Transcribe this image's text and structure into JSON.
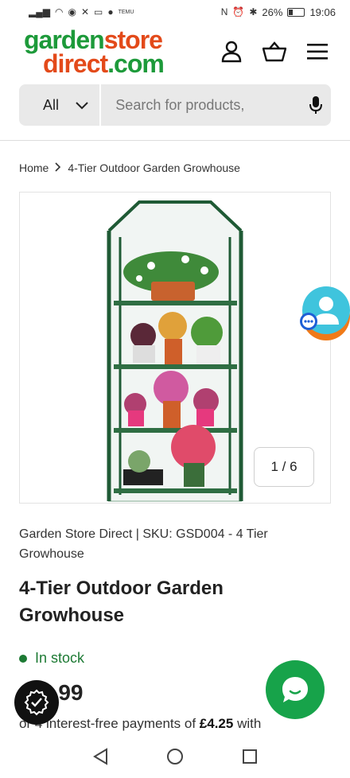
{
  "status": {
    "battery": "26%",
    "time": "19:06",
    "temu": "TEMU"
  },
  "header": {
    "logo_line1_a": "garden",
    "logo_line1_b": "store",
    "logo_line2_a": "direct",
    "logo_line2_b": ".com",
    "icons": [
      "account-icon",
      "basket-icon",
      "menu-icon"
    ]
  },
  "search": {
    "category": "All",
    "placeholder": "Search for products,"
  },
  "breadcrumb": {
    "home": "Home",
    "current": "4-Tier Outdoor Garden Growhouse"
  },
  "gallery": {
    "counter": "1 / 6"
  },
  "product": {
    "meta_line": "Garden Store Direct  |  SKU: GSD004 - 4 Tier Growhouse",
    "title": "4-Tier Outdoor Garden Growhouse",
    "stock": "In stock",
    "price": "5.99",
    "installments_prefix": "or 4 interest-free payments of",
    "installments_amount": "£4.25",
    "installments_suffix": "with"
  },
  "colors": {
    "brand_green": "#1d9a3a",
    "brand_orange": "#e34a1a",
    "chat_green": "#17a34a"
  }
}
